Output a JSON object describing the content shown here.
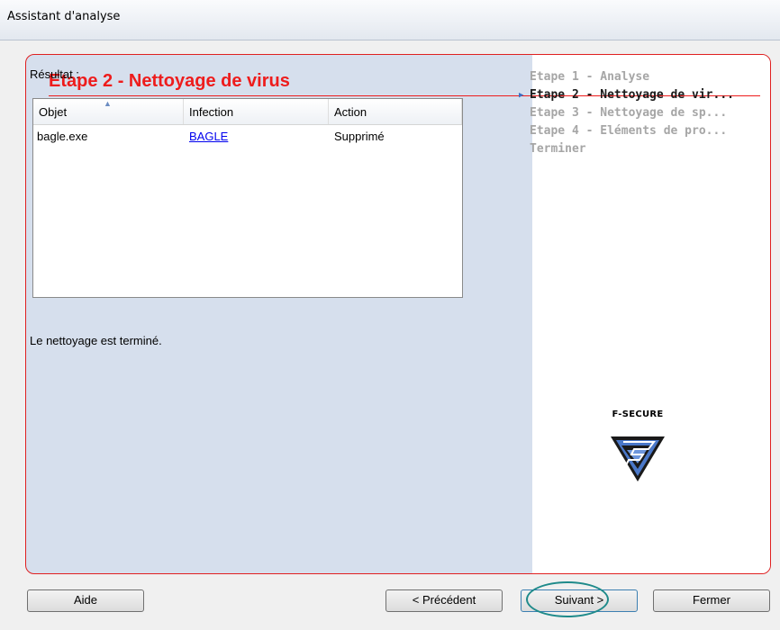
{
  "window": {
    "title": "Assistant d'analyse"
  },
  "main": {
    "heading": "Etape 2 - Nettoyage de virus",
    "result_label": "Résultat :",
    "table": {
      "columns": [
        "Objet",
        "Infection",
        "Action"
      ],
      "rows": [
        {
          "object": "bagle.exe",
          "infection": "BAGLE",
          "action": "Supprimé"
        }
      ]
    },
    "status": "Le nettoyage est terminé."
  },
  "steps": [
    {
      "label": "Etape 1 - Analyse",
      "state": "done"
    },
    {
      "label": "Etape 2 - Nettoyage de vir...",
      "state": "active"
    },
    {
      "label": "Etape 3 - Nettoyage de sp...",
      "state": "pending"
    },
    {
      "label": "Etape 4 - Eléments de pro...",
      "state": "pending"
    },
    {
      "label": "Terminer",
      "state": "pending"
    }
  ],
  "logo": {
    "text": "F-SECURE",
    "icon": "f-secure-logo"
  },
  "buttons": {
    "help": "Aide",
    "previous": "< Précédent",
    "next": "Suivant >",
    "close": "Fermer"
  },
  "colors": {
    "accent_red": "#ee1c1c",
    "left_panel": "#d6dfed",
    "link": "#0000ee",
    "highlight": "#1e8a8a"
  }
}
